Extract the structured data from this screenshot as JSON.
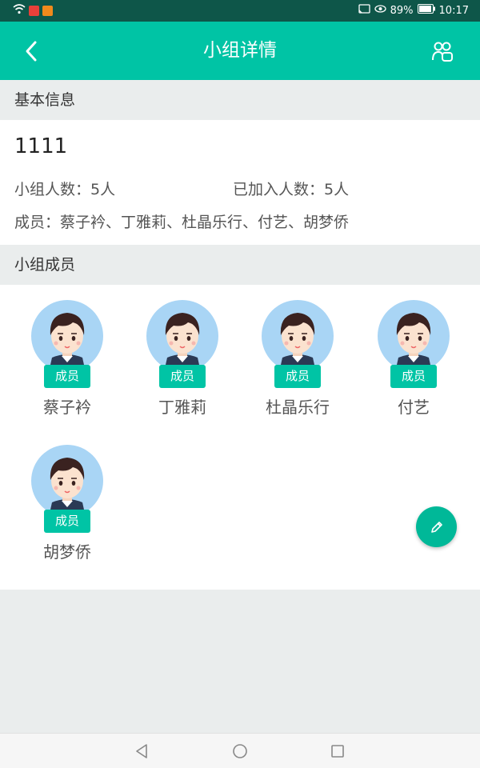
{
  "status_bar": {
    "battery": "89%",
    "time": "10:17"
  },
  "header": {
    "title": "小组详情"
  },
  "basic_info": {
    "section_title": "基本信息",
    "group_name": "1111",
    "group_size_label": "小组人数：5人",
    "joined_label": "已加入人数：5人",
    "members_label": "成员：蔡子衿、丁雅莉、杜晶乐行、付艺、胡梦侨"
  },
  "members_section": {
    "section_title": "小组成员",
    "members": [
      {
        "name": "蔡子衿",
        "role": "成员"
      },
      {
        "name": "丁雅莉",
        "role": "成员"
      },
      {
        "name": "杜晶乐行",
        "role": "成员"
      },
      {
        "name": "付艺",
        "role": "成员"
      },
      {
        "name": "胡梦侨",
        "role": "成员"
      }
    ]
  },
  "colors": {
    "accent": "#00c4a5",
    "status_bar": "#0e5649",
    "avatar_bg": "#a9d5f5"
  },
  "icons": [
    "wifi-icon",
    "back-icon",
    "group-members-icon",
    "edit-icon"
  ]
}
